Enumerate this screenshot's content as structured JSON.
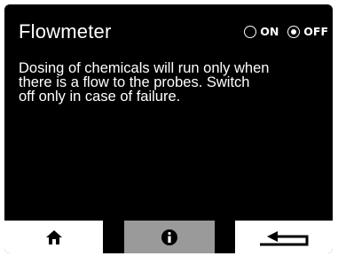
{
  "header": {
    "title": "Flowmeter",
    "toggle": {
      "on_label": "ON",
      "off_label": "OFF",
      "selected": "OFF"
    }
  },
  "body": {
    "description": "Dosing of chemicals will run only when\nthere is a flow to the probes. Switch\noff only in case of failure."
  },
  "nav": {
    "buttons": [
      {
        "icon": "home-icon",
        "state": "normal"
      },
      {
        "icon": "info-icon",
        "state": "active"
      },
      {
        "icon": "back-arrow-icon",
        "state": "normal"
      }
    ]
  },
  "colors": {
    "screen_background": "#000000",
    "text": "#ffffff",
    "button_background": "#ffffff",
    "button_active_background": "#9a9a9a",
    "icon": "#000000"
  }
}
